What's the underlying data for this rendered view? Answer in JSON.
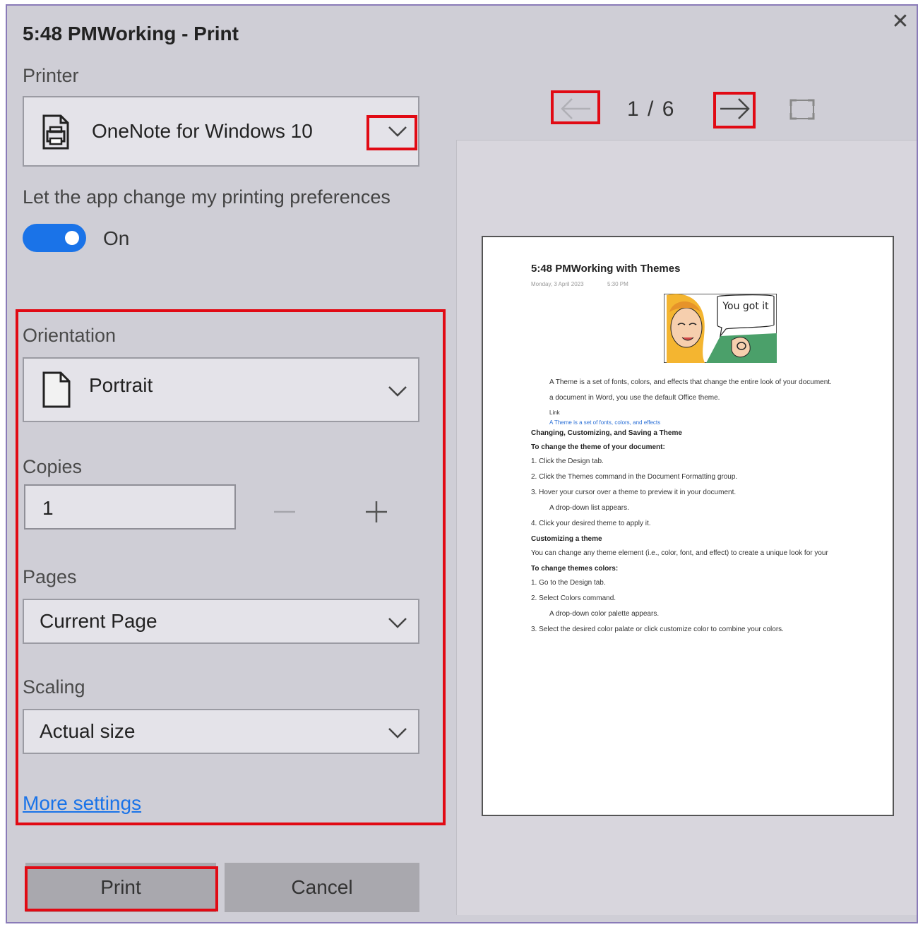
{
  "dialog": {
    "title": "5:48 PMWorking - Print",
    "close_glyph": "✕"
  },
  "printer": {
    "label": "Printer",
    "value": "OneNote for Windows 10",
    "icon": "printer-icon"
  },
  "preferences": {
    "label": "Let the app change my printing preferences",
    "toggle_state": "On"
  },
  "orientation": {
    "label": "Orientation",
    "value": "Portrait",
    "icon": "page-icon"
  },
  "copies": {
    "label": "Copies",
    "value": "1"
  },
  "pages": {
    "label": "Pages",
    "value": "Current Page"
  },
  "scaling": {
    "label": "Scaling",
    "value": "Actual size"
  },
  "more_settings": "More settings",
  "actions": {
    "print": "Print",
    "cancel": "Cancel"
  },
  "preview_nav": {
    "page_counter": "1 / 6"
  },
  "preview_page": {
    "title": "5:48 PMWorking with Themes",
    "date": "Monday, 3 April 2023",
    "time": "5:30 PM",
    "image_caption": "You got it",
    "lines": [
      {
        "text": "A Theme is a set of fonts, colors, and effects that change the entire look of your document.",
        "style": "normal",
        "indent": 1
      },
      {
        "text": "a document in Word, you use the default Office theme.",
        "style": "normal",
        "indent": 1
      },
      {
        "text": "Link",
        "style": "small",
        "indent": 1
      },
      {
        "text": "A Theme is a set of fonts, colors, and effects",
        "style": "link",
        "indent": 1
      },
      {
        "text": "Changing, Customizing, and Saving a Theme",
        "style": "bold",
        "indent": 0
      },
      {
        "text": "To change the theme of your document:",
        "style": "bold",
        "indent": 0
      },
      {
        "text": "1.  Click the Design tab.",
        "style": "normal",
        "indent": 0
      },
      {
        "text": "2.  Click the Themes command in the Document Formatting group.",
        "style": "normal",
        "indent": 0
      },
      {
        "text": "3.  Hover your cursor over a theme to preview it in your document.",
        "style": "normal",
        "indent": 0
      },
      {
        "text": "A drop-down list appears.",
        "style": "normal",
        "indent": 1
      },
      {
        "text": "4.  Click your desired theme to apply it.",
        "style": "normal",
        "indent": 0
      },
      {
        "text": "Customizing a theme",
        "style": "bold",
        "indent": 0
      },
      {
        "text": "You can change any theme element (i.e., color, font, and effect) to create a unique look for your",
        "style": "normal",
        "indent": 0
      },
      {
        "text": "To change themes colors:",
        "style": "bold",
        "indent": 0
      },
      {
        "text": "1.  Go to the Design tab.",
        "style": "normal",
        "indent": 0
      },
      {
        "text": "2.  Select Colors command.",
        "style": "normal",
        "indent": 0
      },
      {
        "text": "A drop-down color palette appears.",
        "style": "normal",
        "indent": 1
      },
      {
        "text": "3.  Select the desired color palate or click customize color to combine your colors.",
        "style": "normal",
        "indent": 0
      }
    ]
  },
  "colors": {
    "highlight": "#e10a14",
    "accent": "#1a73e8",
    "dialog_bg": "#cfced6"
  }
}
